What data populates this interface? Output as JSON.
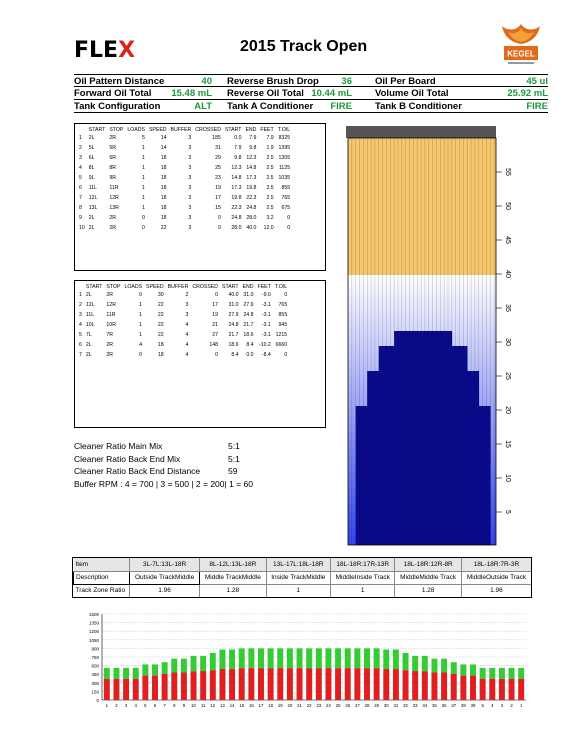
{
  "header": {
    "logo_left": "FLE",
    "logo_x": "X",
    "title": "2015 Track Open",
    "kegel_logo": "KEGEL"
  },
  "colors": {
    "green_value": "#1a9a3a",
    "oil_light": "#f5c66b",
    "lane_dark": "#0a0a8c",
    "bar_red": "#e02020",
    "bar_green": "#33cc33"
  },
  "params": {
    "row1": {
      "l1": "Oil Pattern Distance",
      "v1": "40",
      "l2": "Reverse Brush Drop",
      "v2": "36",
      "l3": "Oil Per Board",
      "v3": "45 ul"
    },
    "row2": {
      "l1": "Forward Oil Total",
      "v1": "15.48 mL",
      "l2": "Reverse Oil Total",
      "v2": "10.44 mL",
      "l3": "Volume Oil Total",
      "v3": "25.92 mL"
    },
    "row3": {
      "l1": "Tank Configuration",
      "v1": "ALT",
      "l2": "Tank A Conditioner",
      "v2": "FIRE",
      "l3": "Tank B Conditioner",
      "v3": "FIRE"
    }
  },
  "forward_table": {
    "headers": [
      "START",
      "STOP",
      "LOADS",
      "SPEED",
      "BUFFER",
      "CROSSED",
      "START",
      "END",
      "FEET",
      "T.OIL"
    ],
    "rows": [
      [
        "1",
        "2L",
        "2R",
        "5",
        "14",
        "3",
        "185",
        "0.0",
        "7.9",
        "7.9",
        "8325"
      ],
      [
        "2",
        "5L",
        "5R",
        "1",
        "14",
        "3",
        "31",
        "7.9",
        "9.8",
        "1.9",
        "1395"
      ],
      [
        "3",
        "6L",
        "6R",
        "1",
        "18",
        "3",
        "29",
        "9.8",
        "12.3",
        "2.5",
        "1305"
      ],
      [
        "4",
        "8L",
        "8R",
        "1",
        "18",
        "3",
        "25",
        "12.3",
        "14.8",
        "2.5",
        "1125"
      ],
      [
        "5",
        "9L",
        "9R",
        "1",
        "18",
        "3",
        "23",
        "14.8",
        "17.3",
        "2.5",
        "1035"
      ],
      [
        "6",
        "11L",
        "11R",
        "1",
        "18",
        "3",
        "19",
        "17.3",
        "19.8",
        "2.5",
        "855"
      ],
      [
        "7",
        "12L",
        "12R",
        "1",
        "18",
        "3",
        "17",
        "19.8",
        "22.3",
        "2.5",
        "765"
      ],
      [
        "8",
        "13L",
        "13R",
        "1",
        "18",
        "3",
        "15",
        "22.3",
        "24.8",
        "2.5",
        "675"
      ],
      [
        "9",
        "2L",
        "2R",
        "0",
        "18",
        "3",
        "0",
        "24.8",
        "28.0",
        "3.2",
        "0"
      ],
      [
        "10",
        "2L",
        "2R",
        "0",
        "22",
        "3",
        "0",
        "28.0",
        "40.0",
        "12.0",
        "0"
      ]
    ]
  },
  "reverse_table": {
    "headers": [
      "START",
      "STOP",
      "LOADS",
      "SPEED",
      "BUFFER",
      "CROSSED",
      "START",
      "END",
      "FEET",
      "T.OIL"
    ],
    "rows": [
      [
        "1",
        "2L",
        "2R",
        "0",
        "30",
        "2",
        "0",
        "40.0",
        "31.0",
        "-9.0",
        "0"
      ],
      [
        "2",
        "12L",
        "12R",
        "1",
        "22",
        "3",
        "17",
        "31.0",
        "27.9",
        "-3.1",
        "765"
      ],
      [
        "3",
        "11L",
        "11R",
        "1",
        "22",
        "3",
        "19",
        "27.9",
        "24.8",
        "-3.1",
        "855"
      ],
      [
        "4",
        "10L",
        "10R",
        "1",
        "22",
        "4",
        "21",
        "24.8",
        "21.7",
        "-3.1",
        "945"
      ],
      [
        "5",
        "7L",
        "7R",
        "1",
        "22",
        "4",
        "27",
        "21.7",
        "18.6",
        "-3.1",
        "1215"
      ],
      [
        "6",
        "2L",
        "2R",
        "4",
        "18",
        "4",
        "148",
        "18.6",
        "8.4",
        "-10.2",
        "6660"
      ],
      [
        "7",
        "2L",
        "2R",
        "0",
        "18",
        "4",
        "0",
        "8.4",
        "0.0",
        "-8.4",
        "0"
      ]
    ]
  },
  "ratios": [
    {
      "label": "Cleaner Ratio Main Mix",
      "value": "5:1"
    },
    {
      "label": "Cleaner Ratio Back End Mix",
      "value": "5:1"
    },
    {
      "label": "Cleaner Ratio Back End Distance",
      "value": "59"
    },
    {
      "label": "Buffer RPM : 4 = 700 | 3 = 500 | 2 = 200| 1 = 60",
      "value": ""
    }
  ],
  "lane_axis": [
    "55",
    "50",
    "45",
    "40",
    "35",
    "30",
    "25",
    "20",
    "15",
    "10",
    "5"
  ],
  "zone_table": {
    "header": [
      "Item",
      "3L-7L:13L-18R",
      "8L-12L:13L-18R",
      "13L-17L:18L-18R",
      "18L-18R:17R-13R",
      "18L-18R:12R-8R",
      "18L-18R:7R-3R"
    ],
    "description": [
      "Description",
      "Outside TrackMiddle",
      "Middle TrackMiddle",
      "Inside TrackMiddle",
      "MiddleInside Track",
      "MiddleMiddle Track",
      "MiddleOutside Track"
    ],
    "ratio": [
      "Track Zone Ratio",
      "1.96",
      "1.28",
      "1",
      "1",
      "1.28",
      "1.96"
    ]
  },
  "chart_data": {
    "type": "bar",
    "categories": [
      "1",
      "2",
      "3",
      "4",
      "5",
      "6",
      "7",
      "8",
      "9",
      "10",
      "11",
      "12",
      "13",
      "14",
      "15",
      "16",
      "17",
      "18",
      "19",
      "20",
      "21",
      "22",
      "23",
      "24",
      "25",
      "26",
      "27",
      "28",
      "29",
      "30",
      "31",
      "32",
      "33",
      "34",
      "35",
      "36",
      "37",
      "38",
      "39",
      "5",
      "4",
      "3",
      "2",
      "1"
    ],
    "yticks": [
      "1500",
      "1350",
      "1200",
      "1050",
      "900",
      "750",
      "600",
      "450",
      "300",
      "150",
      "0"
    ],
    "ylim": [
      0,
      1500
    ],
    "series": [
      {
        "values": [
          370,
          370,
          370,
          370,
          425,
          425,
          455,
          480,
          480,
          500,
          505,
          520,
          540,
          540,
          555,
          555,
          555,
          555,
          555,
          555,
          555,
          555,
          555,
          555,
          555,
          555,
          555,
          555,
          555,
          540,
          540,
          520,
          505,
          500,
          480,
          480,
          455,
          425,
          425,
          370,
          370,
          370,
          370,
          370
        ]
      },
      {
        "values": [
          560,
          560,
          560,
          560,
          620,
          620,
          660,
          720,
          720,
          770,
          770,
          820,
          880,
          880,
          900,
          900,
          900,
          900,
          900,
          900,
          900,
          900,
          900,
          900,
          900,
          900,
          900,
          900,
          900,
          880,
          880,
          820,
          770,
          770,
          720,
          720,
          660,
          620,
          620,
          560,
          560,
          560,
          560,
          560
        ]
      }
    ]
  }
}
